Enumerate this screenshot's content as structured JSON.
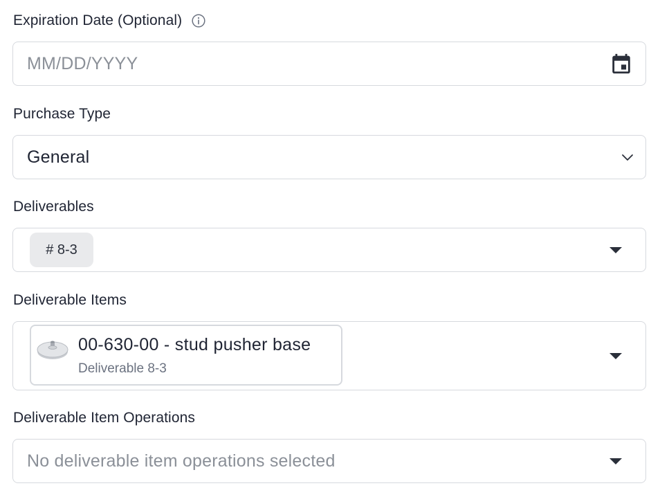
{
  "expiration": {
    "label": "Expiration Date (Optional)",
    "placeholder": "MM/DD/YYYY"
  },
  "purchase_type": {
    "label": "Purchase Type",
    "value": "General"
  },
  "deliverables": {
    "label": "Deliverables",
    "chips": [
      "# 8-3"
    ]
  },
  "deliverable_items": {
    "label": "Deliverable Items",
    "items": [
      {
        "title": "00-630-00 - stud pusher base",
        "subtitle": "Deliverable 8-3"
      }
    ]
  },
  "deliverable_item_operations": {
    "label": "Deliverable Item Operations",
    "placeholder": "No deliverable item operations selected"
  },
  "icons": {
    "info": "info-icon",
    "calendar": "calendar-icon",
    "chevron": "chevron-down-icon",
    "caret": "caret-down-icon",
    "thumbnail": "part-thumbnail"
  },
  "colors": {
    "border": "#d6d9de",
    "text": "#1f2433",
    "placeholder": "#8b9098",
    "chip_bg": "#e9eaec"
  }
}
